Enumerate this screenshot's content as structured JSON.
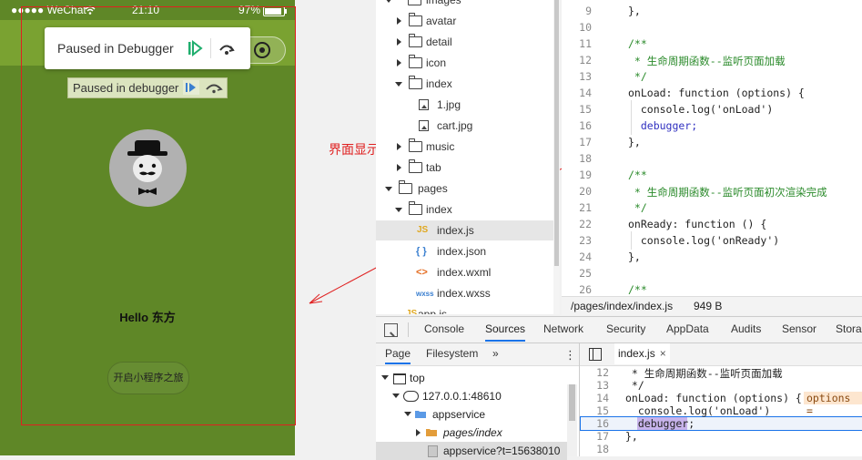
{
  "phone": {
    "status": {
      "carrier": "●●●●● WeChat",
      "time": "21:10",
      "battery": "97%"
    },
    "pause_popup": {
      "label": "Paused in Debugger"
    },
    "pause_banner": {
      "label": "Paused in debugger"
    },
    "hello": "Hello 东方",
    "open_button": "开启小程序之旅"
  },
  "annotation": {
    "text": "界面显示完毕了",
    "color": "#e02020"
  },
  "file_tree": {
    "rows": [
      {
        "label": "images",
        "type": "folder",
        "expanded": true
      },
      {
        "label": "avatar",
        "type": "folder",
        "expanded": false
      },
      {
        "label": "detail",
        "type": "folder",
        "expanded": false
      },
      {
        "label": "icon",
        "type": "folder",
        "expanded": false
      },
      {
        "label": "index",
        "type": "folder",
        "expanded": true
      },
      {
        "label": "1.jpg",
        "type": "image"
      },
      {
        "label": "cart.jpg",
        "type": "image"
      },
      {
        "label": "music",
        "type": "folder",
        "expanded": false
      },
      {
        "label": "tab",
        "type": "folder",
        "expanded": false
      },
      {
        "label": "pages",
        "type": "folder",
        "expanded": true
      },
      {
        "label": "index",
        "type": "folder",
        "expanded": true
      },
      {
        "label": "index.js",
        "type": "js",
        "selected": true
      },
      {
        "label": "index.json",
        "type": "json"
      },
      {
        "label": "index.wxml",
        "type": "wxml"
      },
      {
        "label": "index.wxss",
        "type": "wxss"
      },
      {
        "label": "app.js",
        "type": "js"
      }
    ]
  },
  "editor": {
    "lines": [
      {
        "n": "9",
        "text": "},"
      },
      {
        "n": "10",
        "text": ""
      },
      {
        "n": "11",
        "text": "/**"
      },
      {
        "n": "12",
        "text": " * 生命周期函数--监听页面加载"
      },
      {
        "n": "13",
        "text": " */"
      },
      {
        "n": "14",
        "text": "onLoad: function (options) {"
      },
      {
        "n": "15",
        "text": "  console.log('onLoad')"
      },
      {
        "n": "16",
        "text": "  debugger;"
      },
      {
        "n": "17",
        "text": "},"
      },
      {
        "n": "18",
        "text": ""
      },
      {
        "n": "19",
        "text": "/**"
      },
      {
        "n": "20",
        "text": " * 生命周期函数--监听页面初次渲染完成"
      },
      {
        "n": "21",
        "text": " */"
      },
      {
        "n": "22",
        "text": "onReady: function () {"
      },
      {
        "n": "23",
        "text": "  console.log('onReady')"
      },
      {
        "n": "24",
        "text": "},"
      },
      {
        "n": "25",
        "text": ""
      },
      {
        "n": "26",
        "text": "/**"
      }
    ],
    "status_path": "/pages/index/index.js",
    "status_size": "949 B"
  },
  "devtools": {
    "tabs": [
      "Console",
      "Sources",
      "Network",
      "Security",
      "AppData",
      "Audits",
      "Sensor",
      "Storag"
    ],
    "active_tab": "Sources",
    "left_tabs": [
      "Page",
      "Filesystem"
    ],
    "more": "»",
    "navigator": [
      {
        "label": "top",
        "icon": "window-icon"
      },
      {
        "label": "127.0.0.1:48610",
        "icon": "cloud-icon"
      },
      {
        "label": "appservice",
        "icon": "folder-icon"
      },
      {
        "label": "pages/index",
        "icon": "folder-icon"
      },
      {
        "label": "appservice?t=15638010",
        "icon": "file-icon"
      }
    ],
    "file_tab": "index.js",
    "close": "×",
    "code": [
      {
        "n": "12",
        "text": " * 生命周期函数--监听页面加载"
      },
      {
        "n": "13",
        "text": " */"
      },
      {
        "n": "14",
        "text": "onLoad: function (options) {"
      },
      {
        "n": "15",
        "text": "  console.log('onLoad')"
      },
      {
        "n": "16",
        "text": "  debugger;"
      },
      {
        "n": "17",
        "text": "},"
      },
      {
        "n": "18",
        "text": ""
      }
    ],
    "options_chip": "options ="
  },
  "colors": {
    "phone_bg": "#5f8727",
    "titlebar": "#7aa231",
    "accent": "#1a73e8",
    "annotation": "#e02020"
  }
}
